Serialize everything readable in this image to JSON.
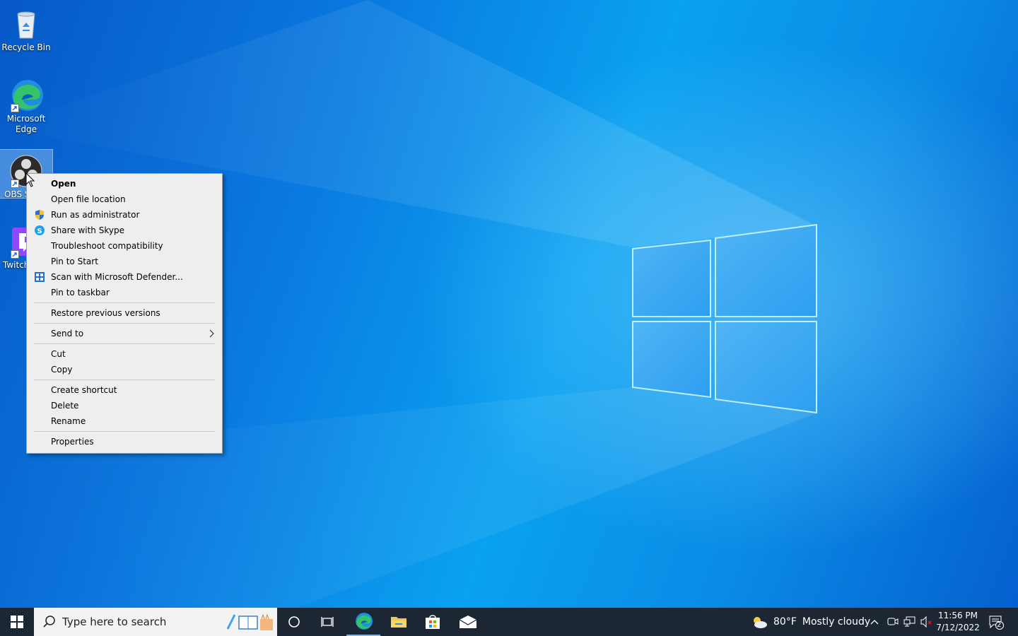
{
  "desktop": {
    "icons": [
      {
        "label": "Recycle Bin",
        "icon": "recycle-bin-icon"
      },
      {
        "label": "Microsoft Edge",
        "icon": "edge-icon"
      },
      {
        "label": "OBS S",
        "icon": "obs-icon"
      },
      {
        "label": "Twitch",
        "icon": "twitch-icon"
      }
    ]
  },
  "context_menu": {
    "items": [
      {
        "label": "Open",
        "bold": true
      },
      {
        "label": "Open file location"
      },
      {
        "label": "Run as administrator",
        "icon": "shield-icon"
      },
      {
        "label": "Share with Skype",
        "icon": "skype-icon"
      },
      {
        "label": "Troubleshoot compatibility"
      },
      {
        "label": "Pin to Start"
      },
      {
        "label": "Scan with Microsoft Defender...",
        "icon": "defender-icon"
      },
      {
        "label": "Pin to taskbar"
      },
      {
        "label": "Restore previous versions"
      },
      {
        "label": "Send to",
        "submenu": true
      },
      {
        "label": "Cut"
      },
      {
        "label": "Copy"
      },
      {
        "label": "Create shortcut"
      },
      {
        "label": "Delete"
      },
      {
        "label": "Rename"
      },
      {
        "label": "Properties"
      }
    ]
  },
  "taskbar": {
    "search_placeholder": "Type here to search",
    "weather_temp": "80°F",
    "weather_desc": "Mostly cloudy",
    "time": "11:56 PM",
    "date": "7/12/2022",
    "notification_count": "2"
  },
  "colors": {
    "taskbar_bg": "#1d2734",
    "menu_bg": "#eeeeee",
    "accent": "#0078d7"
  }
}
